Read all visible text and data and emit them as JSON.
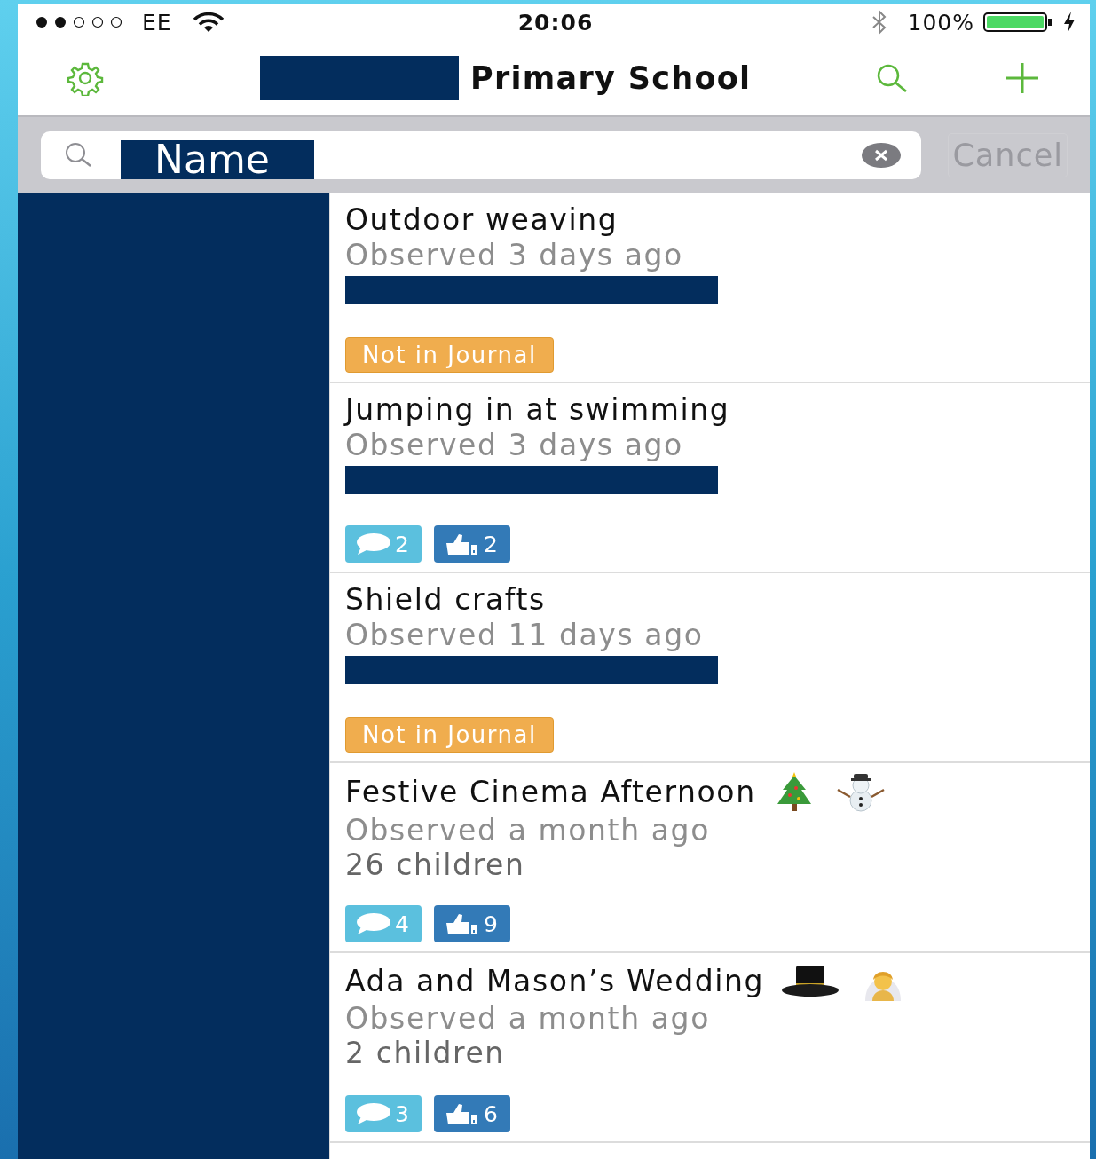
{
  "status_bar": {
    "carrier": "EE",
    "time": "20:06",
    "battery": "100%"
  },
  "nav": {
    "title": "Primary School",
    "title_redacted": true
  },
  "search": {
    "value": "Name",
    "cancel": "Cancel",
    "cancel_disabled": true
  },
  "sidebar": {
    "redacted": true
  },
  "observations": [
    {
      "title": "Outdoor weaving",
      "observed": "Observed 3 days ago",
      "redacted": true,
      "badges": [
        {
          "kind": "journal",
          "label": "Not in Journal"
        }
      ]
    },
    {
      "title": "Jumping in at swimming",
      "observed": "Observed 3 days ago",
      "redacted": true,
      "badges": [
        {
          "kind": "comments",
          "count": "2"
        },
        {
          "kind": "likes",
          "count": "2"
        }
      ]
    },
    {
      "title": "Shield crafts",
      "observed": "Observed 11 days ago",
      "redacted": true,
      "badges": [
        {
          "kind": "journal",
          "label": "Not in Journal"
        }
      ]
    },
    {
      "title": "Festive Cinema Afternoon",
      "decorations": [
        {
          "kind": "tree"
        },
        {
          "kind": "snowman"
        }
      ],
      "observed": "Observed a month ago",
      "detail": "26 children",
      "badges": [
        {
          "kind": "comments",
          "count": "4"
        },
        {
          "kind": "likes",
          "count": "9"
        }
      ]
    },
    {
      "title": "Ada and Mason’s Wedding",
      "decorations": [
        {
          "kind": "hat"
        },
        {
          "kind": "bride"
        }
      ],
      "observed": "Observed a month ago",
      "detail": "2 children",
      "badges": [
        {
          "kind": "comments",
          "count": "3"
        },
        {
          "kind": "likes",
          "count": "6"
        }
      ]
    }
  ]
}
